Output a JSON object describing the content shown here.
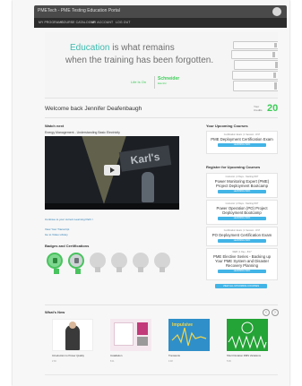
{
  "topbar": {
    "logo": "PMETech - PME Testing Education Portal"
  },
  "nav": {
    "items": [
      "MY PROGRAMS",
      "COURSE CATALOGUE",
      "MY ACCOUNT",
      "LOG OUT"
    ]
  },
  "hero": {
    "accent": "Education",
    "line1_rest": " is what remains",
    "line2": "when the training has been forgotten.",
    "tagline": "Life Is On",
    "brand_name": "Schneider",
    "brand_sub": "Electric"
  },
  "welcome": {
    "text": "Welcome back Jennifer Deafenbaugh",
    "points_label": "Your Credits",
    "points_value": "20"
  },
  "watch_next": {
    "title": "Watch next",
    "video_title": "Energy Management - Understanding Basic Electricity",
    "video_overlay_text": "Karl's",
    "links": [
      "Continue to your current Learning Path >",
      "View Your Transcript",
      "Go to Video Library"
    ]
  },
  "badges": {
    "title": "Badges and Certifications",
    "items": [
      {
        "state": "earned"
      },
      {
        "state": "earned"
      },
      {
        "state": "locked"
      },
      {
        "state": "locked"
      },
      {
        "state": "locked"
      },
      {
        "state": "locked"
      }
    ]
  },
  "upcoming": {
    "title": "Your Upcoming Courses",
    "courses": [
      {
        "meta": "Certification Exam | 1 Session - 8/17",
        "title": "PME Deployment Certification Exam",
        "button": "LEARNING INFO"
      }
    ]
  },
  "register": {
    "title": "Register for Upcoming Courses",
    "courses": [
      {
        "meta": "Instructor | 2 Days - Starting 8/27",
        "title": "Power Monitoring Expert (PME) Project Deployment Bootcamp",
        "button": "LEARNING INFO"
      },
      {
        "meta": "Instructor | 2 Days - Starting 8/27",
        "title": "Power Operation (PO) Project Deployment Bootcamp",
        "button": "LEARNING INFO"
      },
      {
        "meta": "Certification Exam | 1 Session - 8/17",
        "title": "PO Deployment Certification Exam",
        "button": "LEARNING INFO"
      },
      {
        "meta": "WEB | 1 Day - 8/17",
        "title": "PME Elective Series - Backing up Your PME System and Disaster Recovery Planning",
        "button": "LEARNING INFO"
      }
    ],
    "view_all": "VIEW ALL UPCOMING COURSES"
  },
  "whats_new": {
    "title": "What's New",
    "tiles": [
      {
        "title": "Introduction to Power Quality",
        "meta": "2:30",
        "bg": "#ffffff",
        "mark": "#444444"
      },
      {
        "title": "Installation",
        "meta": "8:11",
        "bg": "#f5e9ef",
        "mark": "#c23a7a"
      },
      {
        "title": "Transients",
        "meta": "4:48",
        "bg": "#2f8fc9",
        "mark": "#f2d649"
      },
      {
        "title": "Short Duration RMS Variations",
        "meta": "5:06",
        "bg": "#24a336",
        "mark": "#ffffff"
      }
    ]
  },
  "colors": {
    "accent": "#3dcd58",
    "teal": "#3dbbb0",
    "button": "#42b4e6",
    "topbar": "#4a4a4a",
    "navbar": "#2b2b2b"
  },
  "icons": {
    "play": "play-icon",
    "prev": "chevron-left-icon",
    "next": "chevron-right-icon",
    "avatar": "user-avatar-icon"
  }
}
